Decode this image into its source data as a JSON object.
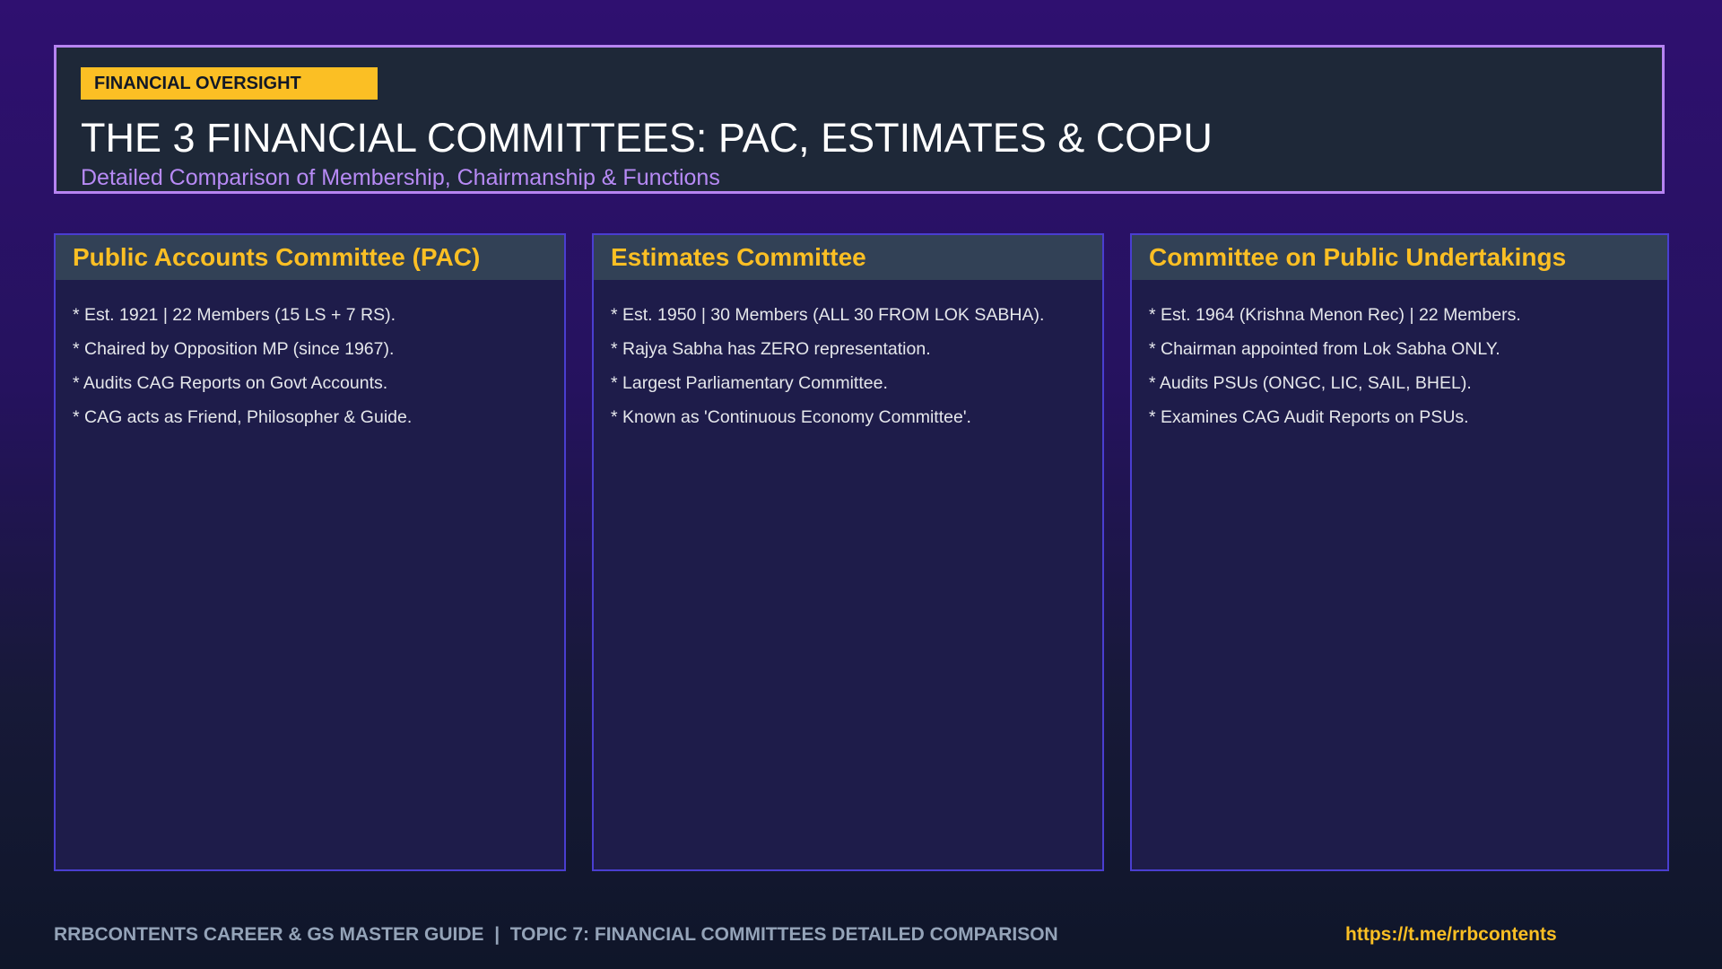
{
  "header": {
    "badge": "FINANCIAL OVERSIGHT",
    "title": "THE 3 FINANCIAL COMMITTEES: PAC, ESTIMATES & COPU",
    "subtitle": "Detailed Comparison of Membership, Chairmanship & Functions"
  },
  "committees": [
    {
      "title": "Public Accounts Committee (PAC)",
      "points": [
        "* Est. 1921 | 22 Members (15 LS + 7 RS).",
        "* Chaired by Opposition MP (since 1967).",
        "* Audits CAG Reports on Govt Accounts.",
        "* CAG acts as Friend, Philosopher & Guide."
      ]
    },
    {
      "title": "Estimates Committee",
      "points": [
        "* Est. 1950 | 30 Members (ALL 30 FROM LOK SABHA).",
        "* Rajya Sabha has ZERO representation.",
        "* Largest Parliamentary Committee.",
        "* Known as 'Continuous Economy Committee'."
      ]
    },
    {
      "title": "Committee on Public Undertakings",
      "points": [
        "* Est. 1964 (Krishna Menon Rec) | 22 Members.",
        "* Chairman appointed from Lok Sabha ONLY.",
        "* Audits PSUs (ONGC, LIC, SAIL, BHEL).",
        "* Examines CAG Audit Reports on PSUs."
      ]
    }
  ],
  "footer": {
    "left": "RRBCONTENTS CAREER & GS MASTER GUIDE  |  TOPIC 7: FINANCIAL COMMITTEES DETAILED COMPARISON",
    "link": "https://t.me/rrbcontents"
  },
  "colors": {
    "accent": "#fbbf24",
    "header_border": "#b784f2",
    "card_border": "#4a3ed0",
    "subtitle": "#b78af5"
  }
}
